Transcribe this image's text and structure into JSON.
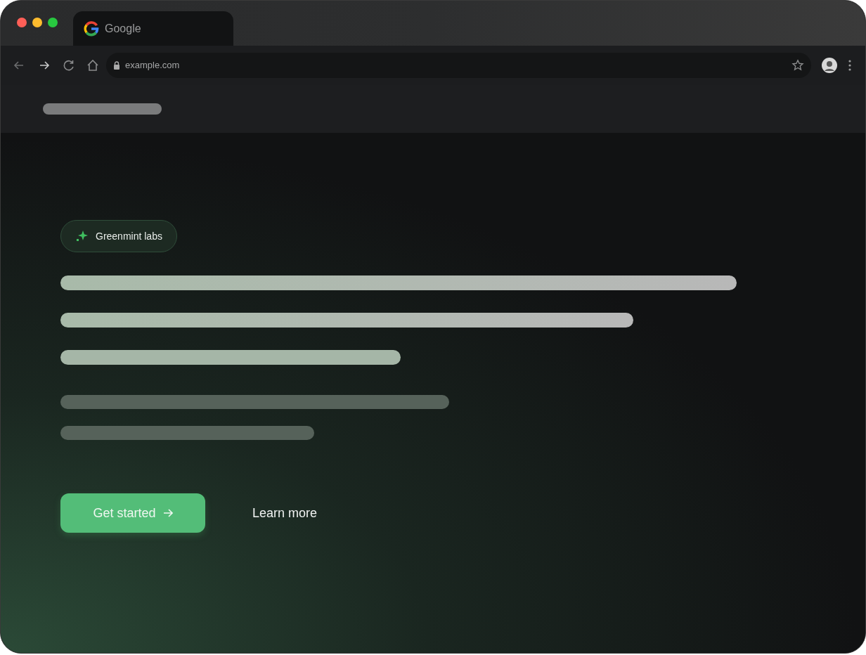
{
  "tab": {
    "title": "Google"
  },
  "address_bar": {
    "url": "example.com"
  },
  "hero": {
    "badge": "Greenmint labs",
    "buttons": [
      {
        "label": "Get started",
        "kind": "primary"
      },
      {
        "label": "Learn more",
        "kind": "link"
      }
    ]
  }
}
